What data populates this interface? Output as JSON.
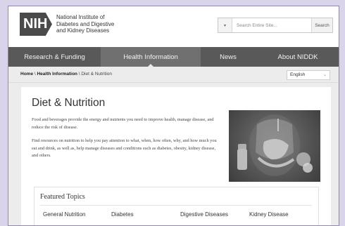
{
  "header": {
    "logo_badge": "NIH",
    "logo_lines": [
      "National Institute of",
      "Diabetes and Digestive",
      "and Kidney Diseases"
    ],
    "search_placeholder": "Search Entire Site...",
    "search_button": "Search",
    "search_scope_icon": "chevron-down-icon"
  },
  "nav": {
    "items": [
      "Research & Funding",
      "Health Information",
      "News",
      "About NIDDK"
    ],
    "active_index": 1
  },
  "breadcrumb": {
    "home": "Home",
    "sep1": " \\ ",
    "section": "Health Information",
    "sep2": " \\ ",
    "current": "Diet & Nutrition"
  },
  "language": {
    "selected": "English"
  },
  "main": {
    "title": "Diet & Nutrition",
    "paragraph1": "Food and beverages provide the energy and nutrients you need to improve health, manage disease, and reduce the risk of disease.",
    "paragraph2": "Find resources on nutrition to help you pay attention to what, when, how often, why, and how much you eat and drink, as well as, help manage diseases and conditions such as diabetes, obesity, kidney disease, and others.",
    "hero_image": "digestive-system-food-illustration"
  },
  "featured": {
    "title": "Featured Topics",
    "topics": [
      "General Nutrition",
      "Diabetes",
      "Digestive Diseases",
      "Kidney Disease"
    ]
  }
}
